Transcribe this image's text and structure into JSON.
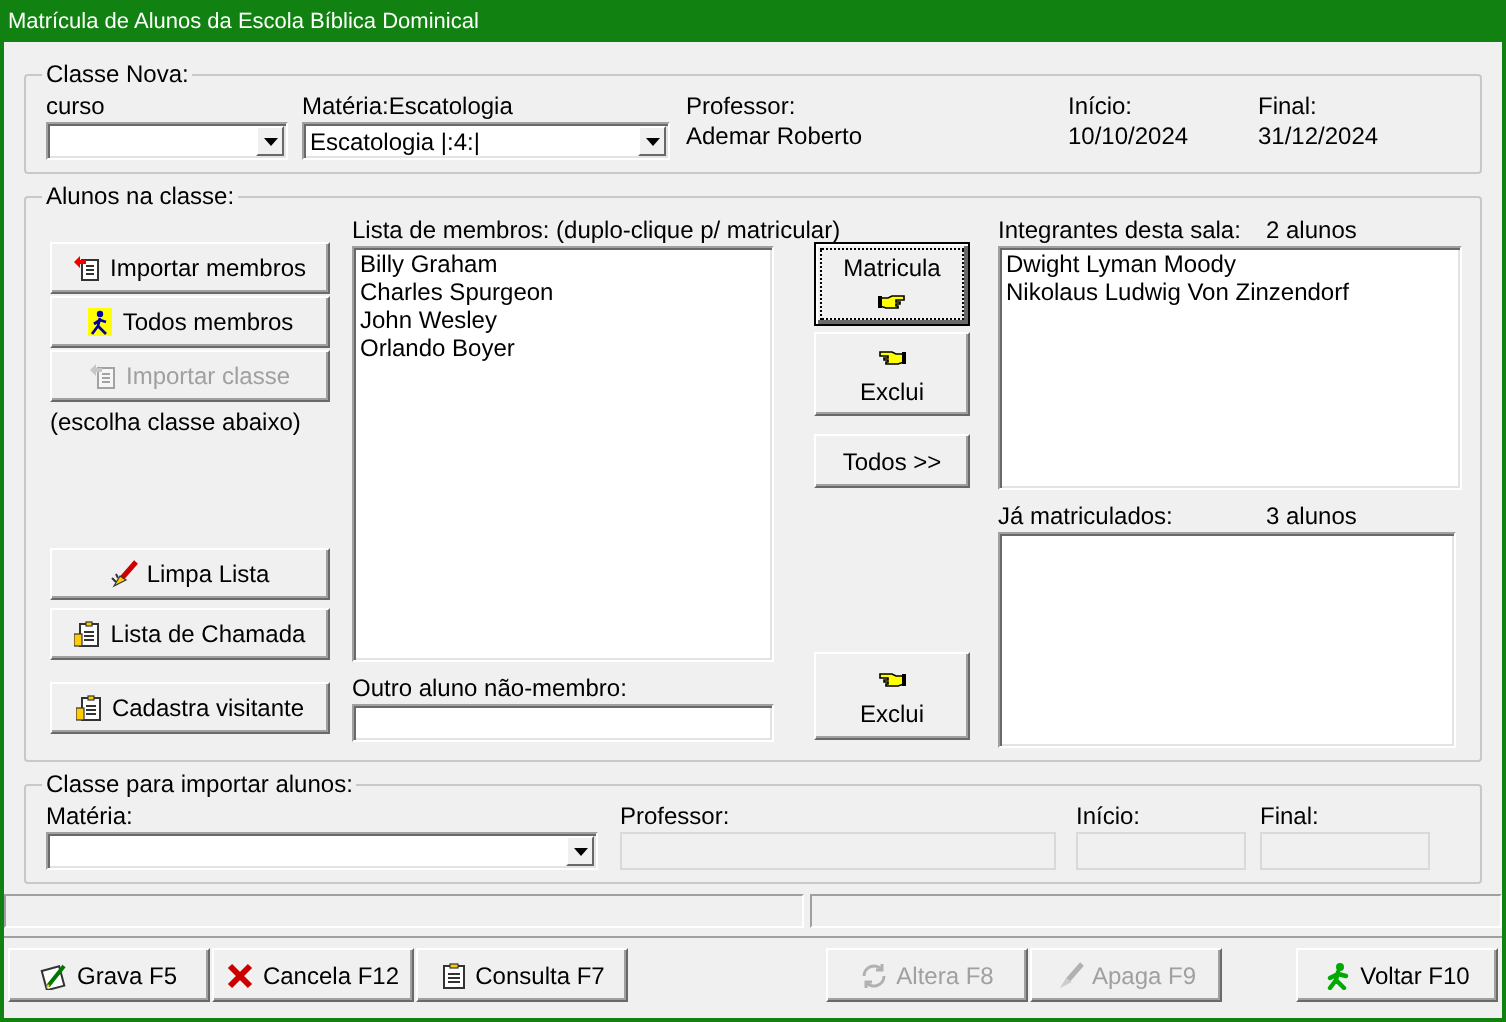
{
  "window": {
    "title": "Matrícula de Alunos da Escola Bíblica Dominical"
  },
  "classe_nova": {
    "legend": "Classe Nova:",
    "curso": {
      "label": "curso"
    },
    "materia": {
      "label": "Matéria:Escatologia",
      "value": "Escatologia |:4:|"
    },
    "professor": {
      "label": "Professor:",
      "value": "Ademar Roberto"
    },
    "inicio": {
      "label": "Início:",
      "value": "10/10/2024"
    },
    "final": {
      "label": "Final:",
      "value": "31/12/2024"
    }
  },
  "alunos": {
    "legend": "Alunos na classe:",
    "import_buttons": [
      {
        "label": "Importar membros",
        "kind": "import",
        "disabled": false
      },
      {
        "label": "Todos membros",
        "kind": "all",
        "disabled": false
      },
      {
        "label": "Importar classe",
        "kind": "import",
        "disabled": true
      }
    ],
    "hint": "(escolha classe abaixo)",
    "list_buttons": [
      {
        "label": "Limpa Lista",
        "kind": "clear",
        "disabled": false
      },
      {
        "label": "Lista de Chamada",
        "kind": "roll",
        "disabled": false
      },
      {
        "label": "Cadastra visitante",
        "kind": "roll",
        "disabled": false
      }
    ],
    "members": {
      "label": "Lista de membros: (duplo-clique p/ matricular)",
      "items": [
        "Billy Graham",
        "Charles Spurgeon",
        "John Wesley",
        "Orlando Boyer"
      ]
    },
    "other": {
      "label": "Outro aluno não-membro:"
    },
    "transfer_buttons": [
      {
        "label": "Matricula",
        "kind": "enroll",
        "focused": true
      },
      {
        "label": "Exclui",
        "kind": "remove",
        "focused": false
      },
      {
        "label": "Todos >>",
        "kind": "plain",
        "focused": false
      }
    ],
    "remove_button": {
      "label": "Exclui"
    },
    "room": {
      "label": "Integrantes desta sala:",
      "count": "2 alunos",
      "items": [
        "Dwight Lyman Moody",
        "Nikolaus Ludwig Von Zinzendorf"
      ]
    },
    "enrolled": {
      "label": "Já matriculados:",
      "count": "3 alunos"
    }
  },
  "import_class": {
    "legend": "Classe para importar alunos:",
    "materia": {
      "label": "Matéria:"
    },
    "professor": {
      "label": "Professor:"
    },
    "inicio": {
      "label": "Início:"
    },
    "final": {
      "label": "Final:"
    }
  },
  "toolbar": {
    "groups": [
      {
        "buttons": [
          {
            "label": "Grava F5",
            "kind": "save",
            "disabled": false
          },
          {
            "label": "Cancela F12",
            "kind": "cancel",
            "disabled": false
          },
          {
            "label": "Consulta F7",
            "kind": "query",
            "disabled": false
          }
        ]
      },
      {
        "buttons": [
          {
            "label": "Altera F8",
            "kind": "edit",
            "disabled": true
          },
          {
            "label": "Apaga F9",
            "kind": "erase",
            "disabled": true
          }
        ]
      },
      {
        "buttons": [
          {
            "label": "Voltar F10",
            "kind": "back",
            "disabled": false
          }
        ]
      }
    ]
  }
}
